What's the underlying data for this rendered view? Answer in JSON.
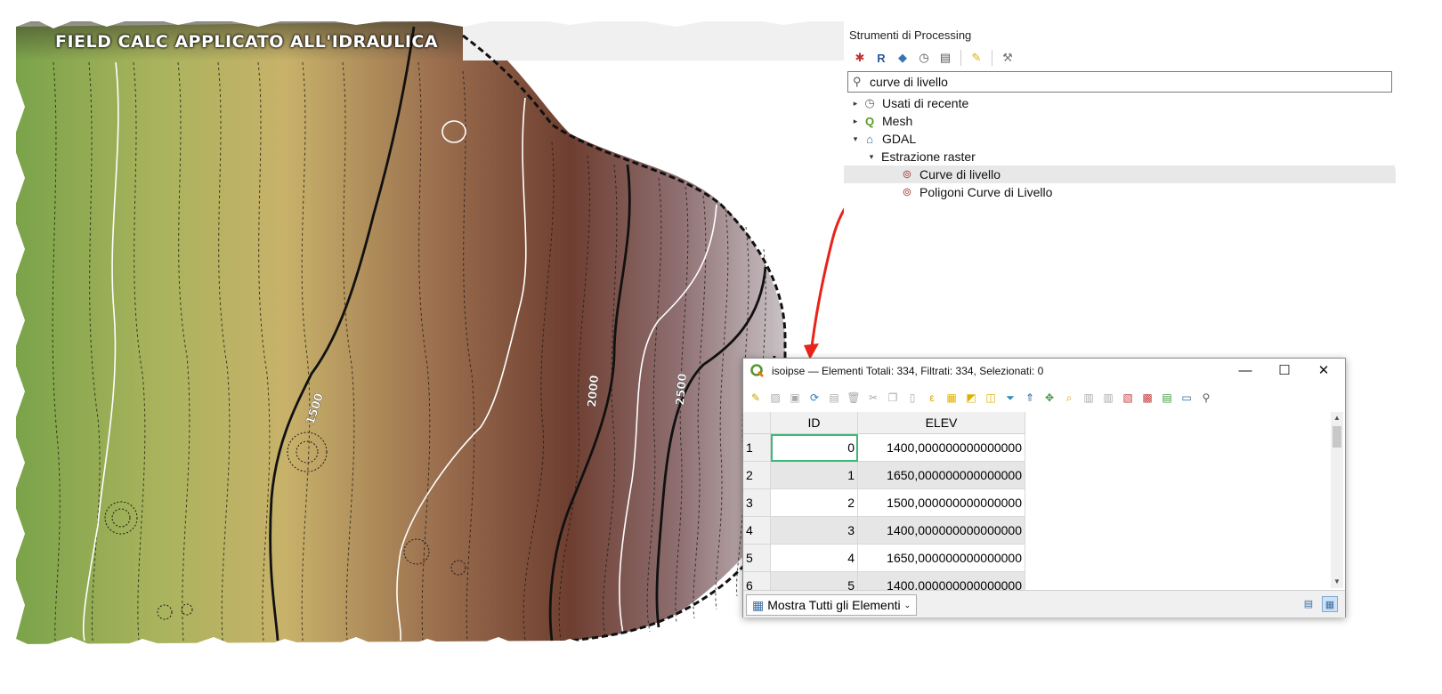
{
  "banner": {
    "title": "FIELD CALC APPLICATO ALL'IDRAULICA"
  },
  "map": {
    "contour_labels": [
      "1500",
      "2000",
      "2500"
    ],
    "colors": {
      "low": "#7aa34a",
      "mid": "#c8b26a",
      "high": "#6e3e30",
      "peak": "#c9c2c6"
    }
  },
  "processing": {
    "title": "Strumenti di Processing",
    "toolbar": [
      "processing-models-icon",
      "r-icon",
      "python-icon",
      "history-icon",
      "results-icon",
      "edit-in-place-icon",
      "options-icon"
    ],
    "search": {
      "value": "curve di livello",
      "placeholder": ""
    },
    "tree": [
      {
        "label": "Usati di recente",
        "icon": "clock-icon",
        "expander": "▸"
      },
      {
        "label": "Mesh",
        "icon": "qgis-icon",
        "expander": "▸"
      },
      {
        "label": "GDAL",
        "icon": "gdal-icon",
        "expander": "▾"
      },
      {
        "label": "Estrazione raster",
        "icon": "",
        "expander": "▾"
      },
      {
        "label": "Curve di livello",
        "icon": "algorithm-icon",
        "expander": ""
      },
      {
        "label": "Poligoni Curve di Livello",
        "icon": "algorithm-icon",
        "expander": ""
      }
    ]
  },
  "attribute_table": {
    "title": "isoipse — Elementi Totali: 334,  Filtrati: 334, Selezionati: 0",
    "controls": {
      "minimize": "—",
      "maximize": "☐",
      "close": "✕"
    },
    "columns": [
      "ID",
      "ELEV"
    ],
    "rows": [
      {
        "n": "1",
        "id": "0",
        "elev": "1400,000000000000000"
      },
      {
        "n": "2",
        "id": "1",
        "elev": "1650,000000000000000"
      },
      {
        "n": "3",
        "id": "2",
        "elev": "1500,000000000000000"
      },
      {
        "n": "4",
        "id": "3",
        "elev": "1400,000000000000000"
      },
      {
        "n": "5",
        "id": "4",
        "elev": "1650,000000000000000"
      },
      {
        "n": "6",
        "id": "5",
        "elev": "1400,000000000000000"
      }
    ],
    "filter_button": "Mostra Tutti gli Elementi"
  },
  "annotation": {
    "arrow_color": "#e8231a"
  }
}
